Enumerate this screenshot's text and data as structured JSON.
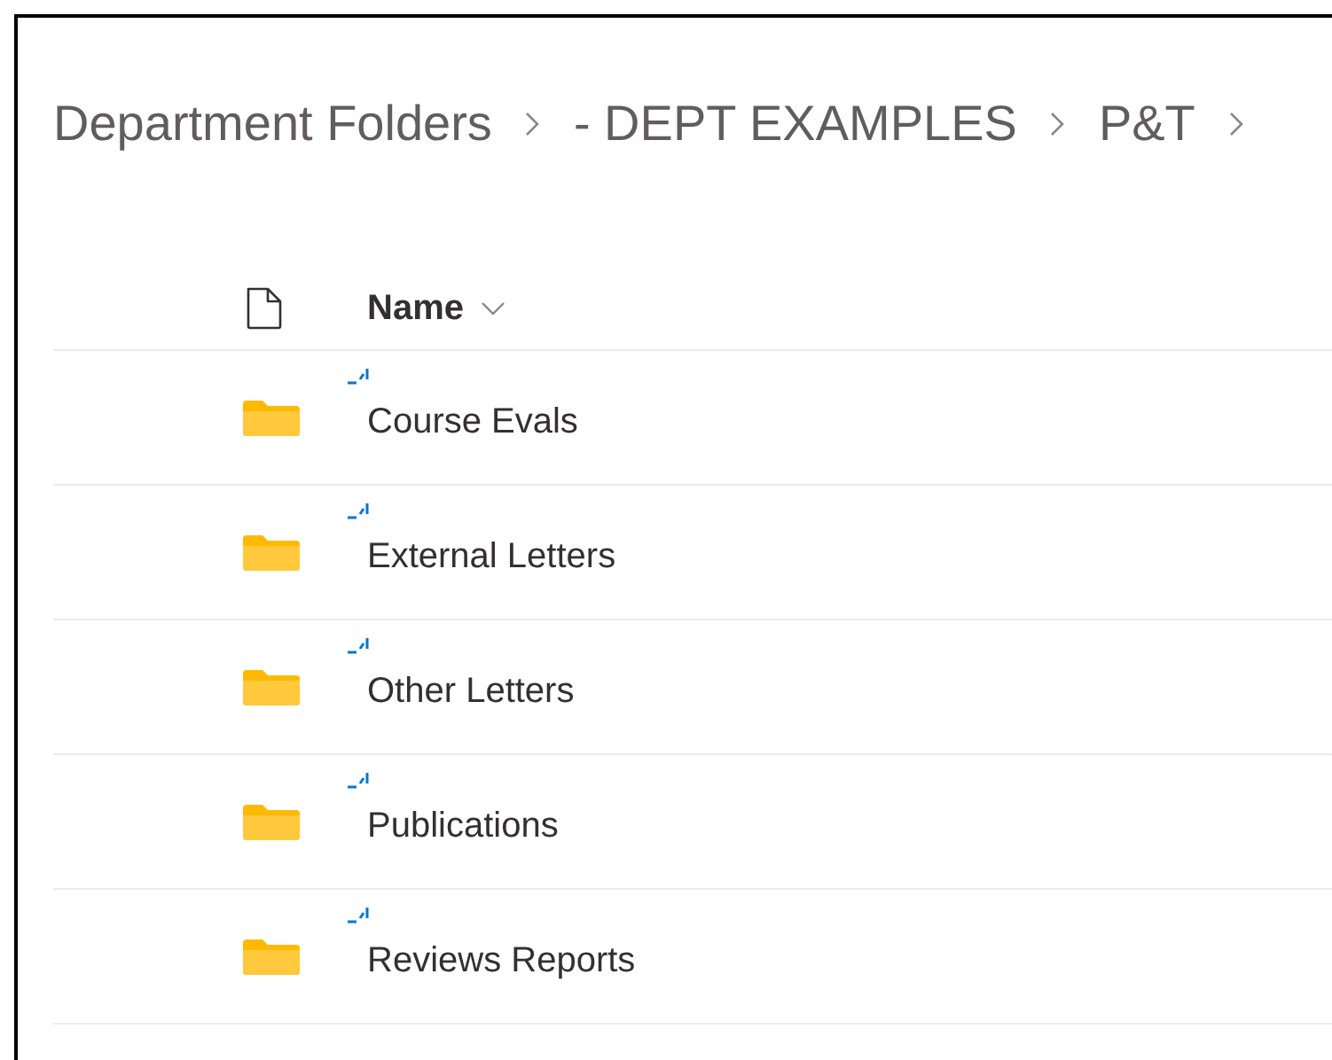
{
  "breadcrumb": [
    "Department Folders",
    "- DEPT EXAMPLES",
    "P&T"
  ],
  "list": {
    "columns": [
      {
        "label": "Name",
        "sorted": true
      }
    ],
    "rows": [
      {
        "name": "Course Evals",
        "new": true
      },
      {
        "name": "External Letters",
        "new": true
      },
      {
        "name": "Other Letters",
        "new": true
      },
      {
        "name": "Publications",
        "new": true
      },
      {
        "name": "Reviews Reports",
        "new": true
      }
    ]
  }
}
